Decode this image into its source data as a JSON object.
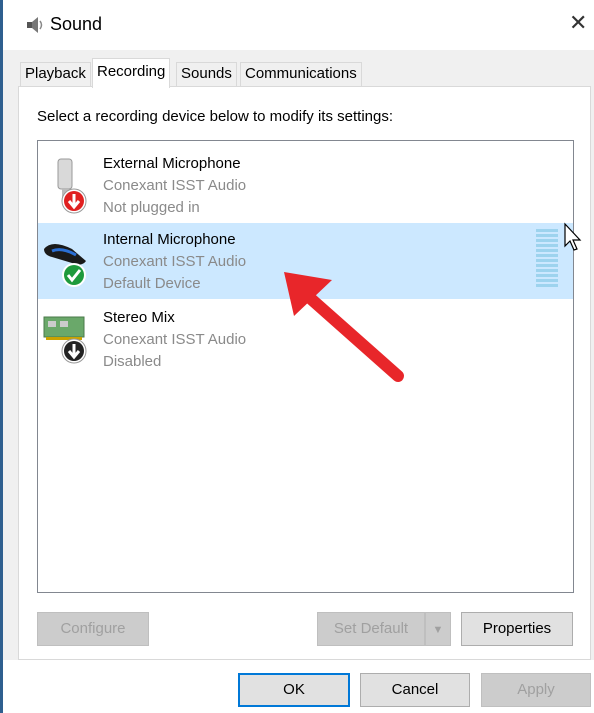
{
  "window": {
    "title": "Sound"
  },
  "tabs": [
    {
      "label": "Playback",
      "active": false
    },
    {
      "label": "Recording",
      "active": true
    },
    {
      "label": "Sounds",
      "active": false
    },
    {
      "label": "Communications",
      "active": false
    }
  ],
  "instruction": "Select a recording device below to modify its settings:",
  "devices": [
    {
      "name": "External Microphone",
      "driver": "Conexant ISST Audio",
      "status": "Not plugged in",
      "selected": false,
      "icon": "microphone-unplugged-icon"
    },
    {
      "name": "Internal Microphone",
      "driver": "Conexant ISST Audio",
      "status": "Default Device",
      "selected": true,
      "icon": "microphone-default-icon"
    },
    {
      "name": "Stereo Mix",
      "driver": "Conexant ISST Audio",
      "status": "Disabled",
      "selected": false,
      "icon": "sound-card-disabled-icon"
    }
  ],
  "buttons": {
    "configure": "Configure",
    "set_default": "Set Default",
    "properties": "Properties",
    "ok": "OK",
    "cancel": "Cancel",
    "apply": "Apply"
  },
  "colors": {
    "selection": "#cce8ff",
    "annotation_arrow": "#e8262a",
    "default_button_border": "#0078d7"
  }
}
